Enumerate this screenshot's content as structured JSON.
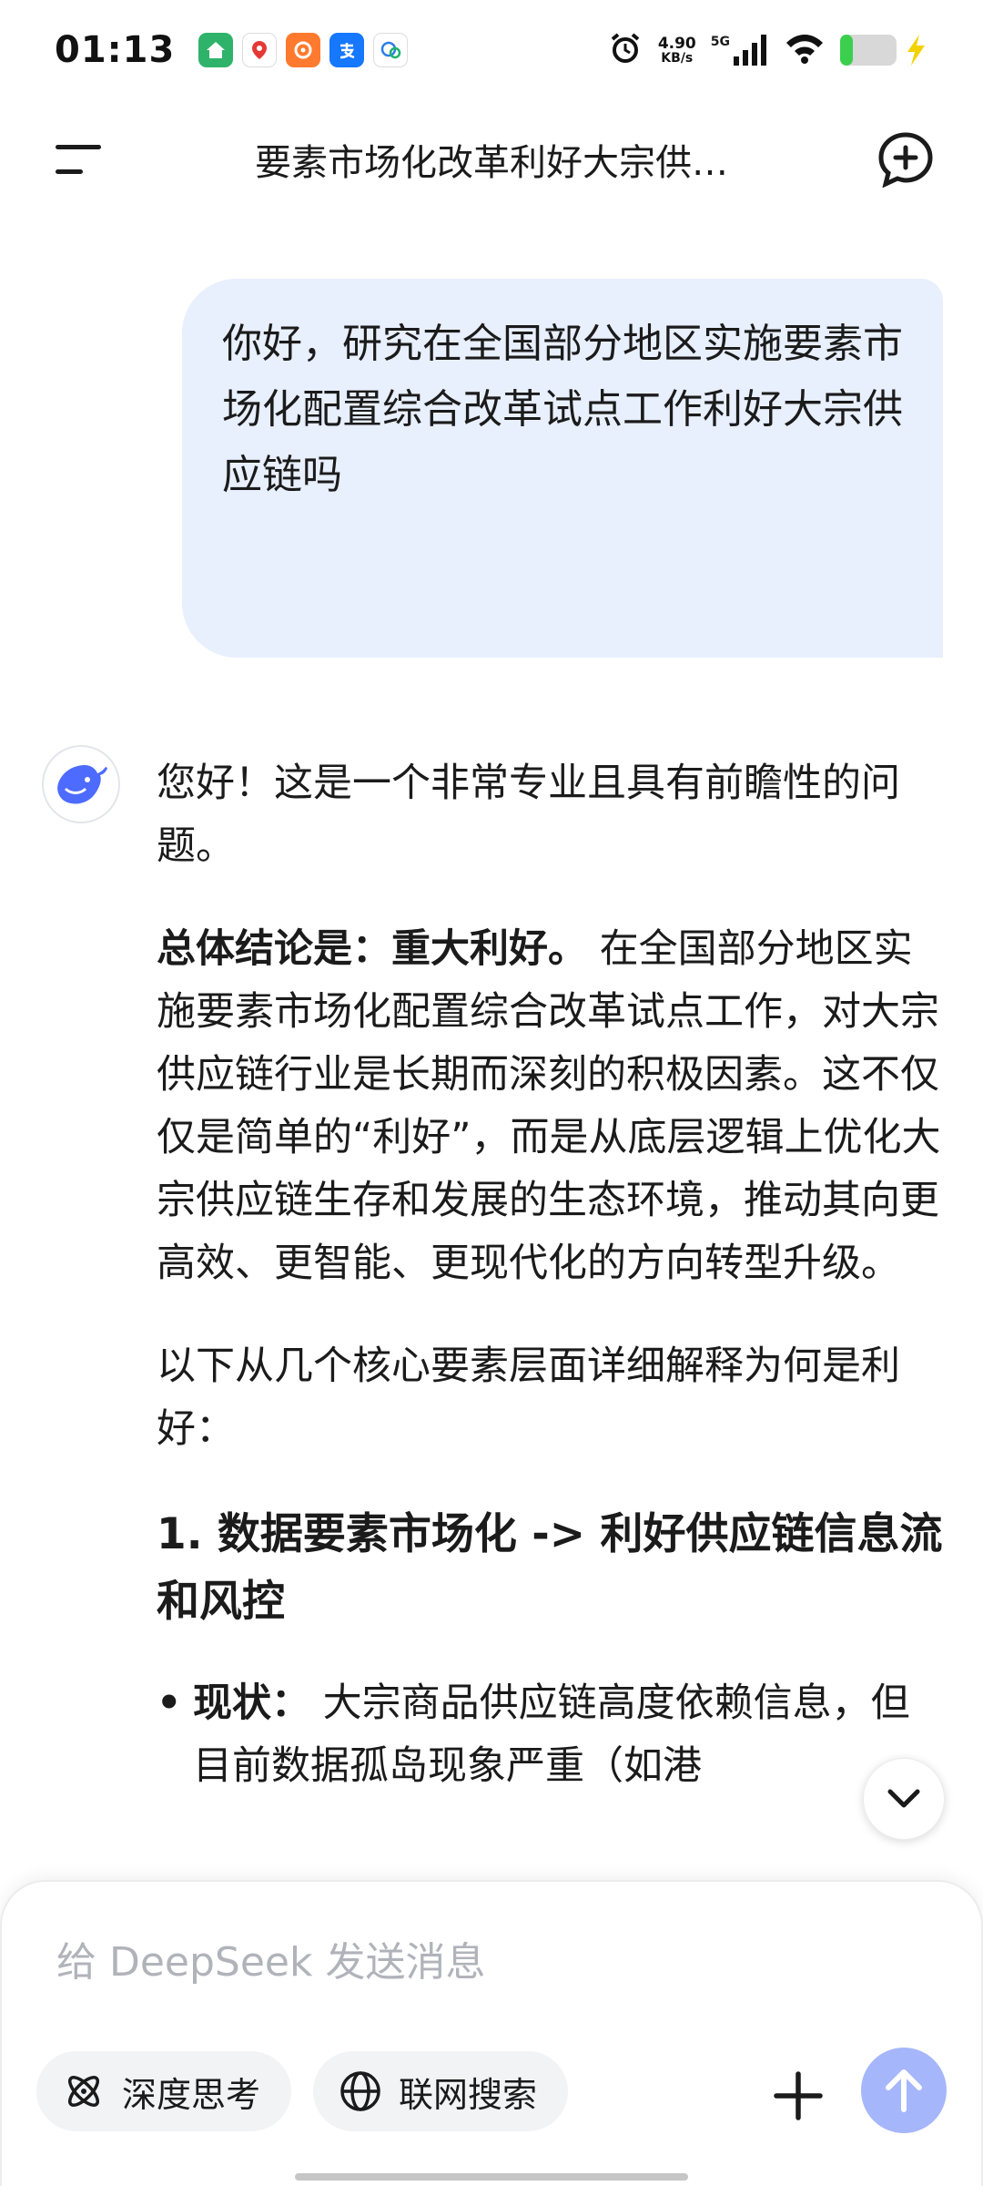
{
  "status_bar": {
    "time": "01:13",
    "net_speed_value": "4.90",
    "net_speed_unit": "KB/s",
    "network_type": "5G"
  },
  "header": {
    "title": "要素市场化改革利好大宗供…"
  },
  "user_message": "你好，研究在全国部分地区实施要素市场化配置综合改革试点工作利好大宗供应链吗",
  "assistant": {
    "greeting": "您好！这是一个非常专业且具有前瞻性的问题。",
    "conclusion_bold": "总体结论是：重大利好。",
    "conclusion_text": " 在全国部分地区实施要素市场化配置综合改革试点工作，对大宗供应链行业是长期而深刻的积极因素。这不仅仅是简单的“利好”，而是从底层逻辑上优化大宗供应链生存和发展的生态环境，推动其向更高效、更智能、更现代化的方向转型升级。",
    "intro": "以下从几个核心要素层面详细解释为何是利好：",
    "section1_title": "1. 数据要素市场化 -> 利好供应链信息流和风控",
    "bullet1_label": "现状：",
    "bullet1_text": " 大宗商品供应链高度依赖信息，但目前数据孤岛现象严重（如港"
  },
  "input": {
    "placeholder": "给 DeepSeek 发送消息"
  },
  "chips": {
    "deep_think": "深度思考",
    "web_search": "联网搜索"
  },
  "colors": {
    "user_bubble": "#e8effd",
    "send_button": "#a6b6fa",
    "brand_blue": "#4d6bfe"
  }
}
